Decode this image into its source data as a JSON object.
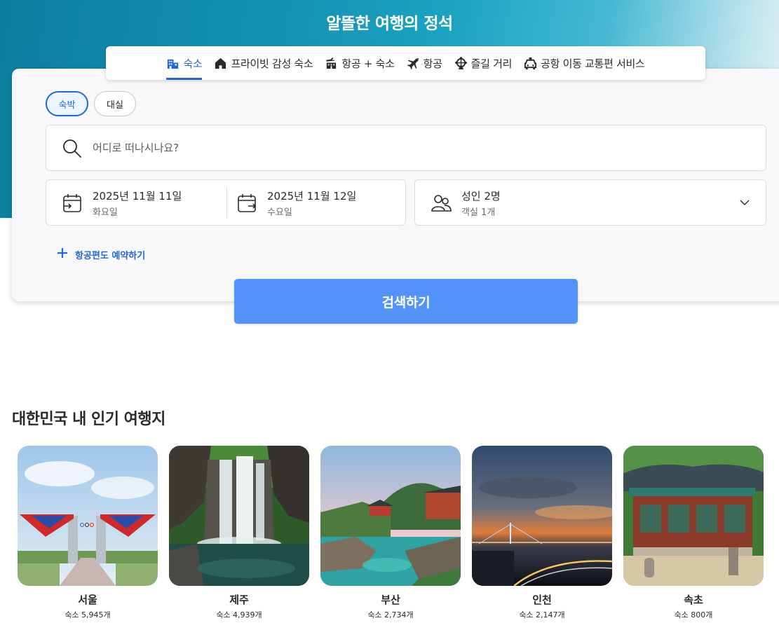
{
  "hero": {
    "title": "알뜰한 여행의 정석"
  },
  "tabs": [
    {
      "label": "숙소",
      "icon": "hotel-icon",
      "active": true
    },
    {
      "label": "프라이빗 감성 숙소",
      "icon": "house-icon",
      "active": false
    },
    {
      "label": "항공 + 숙소",
      "icon": "flight-hotel-icon",
      "active": false
    },
    {
      "label": "항공",
      "icon": "airplane-icon",
      "active": false
    },
    {
      "label": "즐길 거리",
      "icon": "ferris-wheel-icon",
      "active": false
    },
    {
      "label": "공항 이동 교통편 서비스",
      "icon": "car-icon",
      "active": false
    }
  ],
  "stay_type": {
    "overnight": "숙박",
    "day_use": "대실",
    "selected": "숙박"
  },
  "destination": {
    "placeholder": "어디로 떠나시나요?",
    "value": ""
  },
  "checkin": {
    "date": "2025년 11월 11일",
    "weekday": "화요일"
  },
  "checkout": {
    "date": "2025년 11월 12일",
    "weekday": "수요일"
  },
  "guests": {
    "summary": "성인 2명",
    "rooms": "객실 1개"
  },
  "add_flight": {
    "label": "항공편도 예약하기"
  },
  "search_button": {
    "label": "검색하기"
  },
  "popular": {
    "title": "대한민국 내 인기 여행지",
    "destinations": [
      {
        "name": "서울",
        "count": "숙소 5,945개"
      },
      {
        "name": "제주",
        "count": "숙소 4,939개"
      },
      {
        "name": "부산",
        "count": "숙소 2,734개"
      },
      {
        "name": "인천",
        "count": "숙소 2,147개"
      },
      {
        "name": "속초",
        "count": "숙소 800개"
      }
    ]
  },
  "colors": {
    "accent": "#2067da",
    "button": "#5392f9",
    "hero": "#1592b3"
  }
}
